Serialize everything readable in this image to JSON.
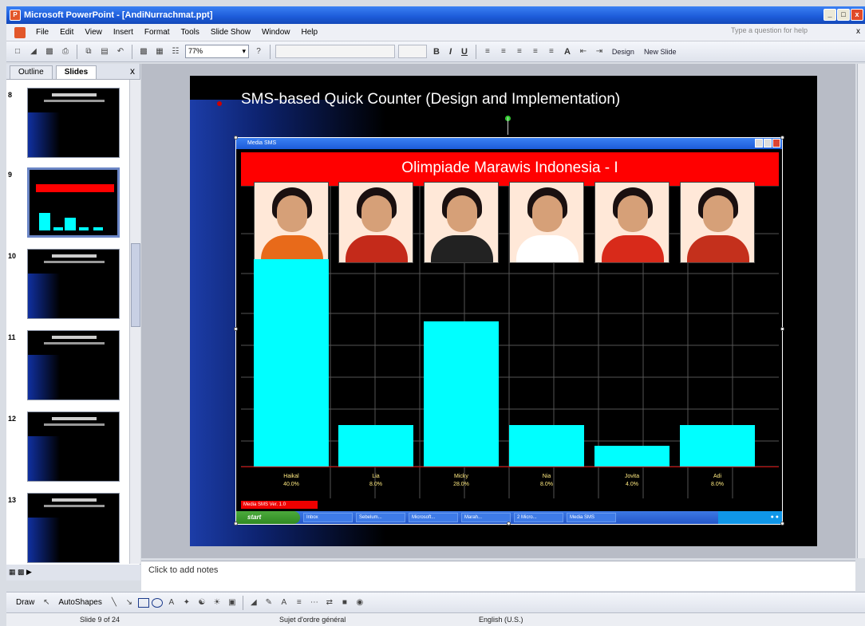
{
  "window": {
    "title": "Microsoft PowerPoint - [AndiNurrachmat.ppt]",
    "buttons": [
      "_",
      "□",
      "x"
    ]
  },
  "menu": {
    "items": [
      "File",
      "Edit",
      "View",
      "Insert",
      "Format",
      "Tools",
      "Slide Show",
      "Window",
      "Help"
    ],
    "ask_placeholder": "Type a question for help",
    "close": "x"
  },
  "toolbar": {
    "zoom": "77%",
    "bold": "B",
    "italic": "I",
    "underline": "U",
    "font_grow": "A",
    "design_label": "Design",
    "new_slide_label": "New Slide"
  },
  "left_pane": {
    "tabs": [
      "Outline",
      "Slides"
    ],
    "active_tab": "Slides",
    "close": "x",
    "thumbnails": [
      {
        "number": "8"
      },
      {
        "number": "9",
        "selected": true
      },
      {
        "number": "10"
      },
      {
        "number": "11"
      },
      {
        "number": "12"
      },
      {
        "number": "13"
      }
    ]
  },
  "slide": {
    "title": "SMS-based Quick Counter (Design and Implementation)",
    "embedded_window": {
      "title": "Media SMS",
      "banner": "Olimpiade Marawis Indonesia - I",
      "status": "Media SMS Ver. 1.0",
      "start": "start",
      "taskbar_items": [
        "Inbox",
        "Sebelum...",
        "Microsoft...",
        "Marah...",
        "2 Micro...",
        "Media SMS"
      ]
    }
  },
  "chart_data": {
    "type": "bar",
    "categories": [
      "Haikal",
      "Lia",
      "Micky",
      "Nia",
      "Jovita",
      "Adi"
    ],
    "labels": [
      "40.0%",
      "8.0%",
      "28.0%",
      "8.0%",
      "4.0%",
      "8.0%"
    ],
    "values": [
      40,
      8,
      28,
      8,
      4,
      8
    ],
    "ylim": [
      0,
      100
    ],
    "colors": {
      "bar": "#00ffff",
      "banner": "#ff0000",
      "background": "#000000"
    }
  },
  "notes": {
    "placeholder": "Click to add notes"
  },
  "drawing_toolbar": {
    "draw": "Draw",
    "autoshapes": "AutoShapes"
  },
  "status_bar": {
    "slide": "Slide 9 of 24",
    "design": "Sujet d'ordre général",
    "language": "English (U.S.)"
  }
}
